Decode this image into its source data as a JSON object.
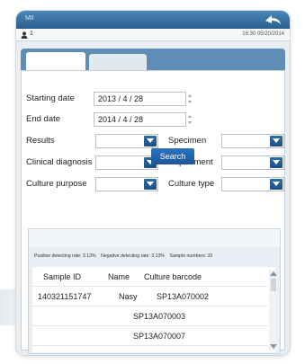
{
  "header": {
    "app_name": "MII",
    "user_number": "1",
    "datetime": "16:30 05/20/2014"
  },
  "form": {
    "starting_date_label": "Starting date",
    "starting_date_value": "2013 / 4 / 28",
    "end_date_label": "End date",
    "end_date_value": "2014 / 4 / 28",
    "results_label": "Results",
    "specimen_label": "Specimen",
    "clinical_diagnosis_label": "Clinical diagnosis",
    "department_label": "Department",
    "culture_purpose_label": "Culture purpose",
    "culture_type_label": "Culture type",
    "search_label": "Search"
  },
  "stats": {
    "positive": "Positive detecting rate: 3.13%",
    "negative": "Negative detecting rate: 3.13%",
    "sample_numbers": "Sample numbers: 32"
  },
  "table": {
    "columns": [
      "Sample ID",
      "Name",
      "Culture barcode"
    ],
    "rows": [
      [
        "140321151747",
        "Nasy",
        "SP13A070002"
      ],
      [
        "",
        "",
        "SP13A070003"
      ],
      [
        "",
        "",
        "SP13A070007"
      ]
    ]
  },
  "colors": {
    "titlebar": "#2a5f8e",
    "accent": "#1c5799",
    "tab_bar": "#5f8db6"
  }
}
